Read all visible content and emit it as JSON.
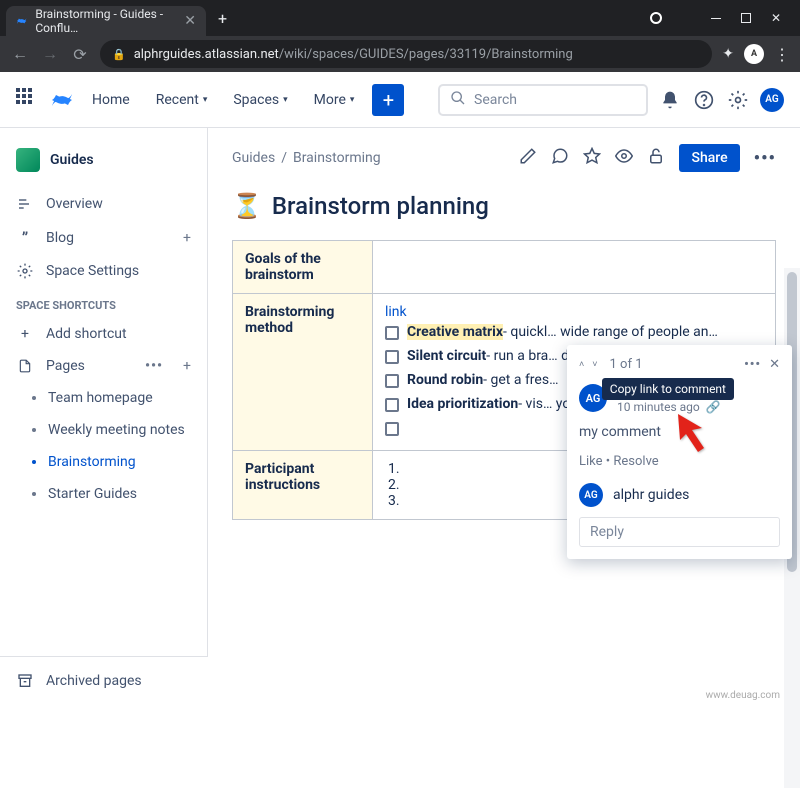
{
  "browser": {
    "tab_title": "Brainstorming - Guides - Conflu…",
    "url_host": "alphrguides.atlassian.net",
    "url_path": "/wiki/spaces/GUIDES/pages/33119/Brainstorming"
  },
  "topnav": {
    "home": "Home",
    "recent": "Recent",
    "spaces": "Spaces",
    "more": "More",
    "search_placeholder": "Search",
    "avatar": "AG"
  },
  "sidebar": {
    "space": "Guides",
    "overview": "Overview",
    "blog": "Blog",
    "space_settings": "Space Settings",
    "shortcuts_hdr": "SPACE SHORTCUTS",
    "add_shortcut": "Add shortcut",
    "pages": "Pages",
    "tree": {
      "team_homepage": "Team homepage",
      "weekly": "Weekly meeting notes",
      "brainstorming": "Brainstorming",
      "starter": "Starter Guides"
    },
    "archived": "Archived pages"
  },
  "breadcrumb": {
    "space": "Guides",
    "page": "Brainstorming"
  },
  "page_actions": {
    "share": "Share"
  },
  "page": {
    "title": "Brainstorm planning",
    "rows": {
      "goals_hdr": "Goals of the brainstorm",
      "method_hdr": "Brainstorming method",
      "method_link": "link",
      "cm_label": "Creative matrix",
      "cm_rest": "- quickl… wide range of people an…",
      "sc_label": "Silent circuit",
      "sc_rest": "- run a bra… different learning styles…",
      "rr_label": "Round robin",
      "rr_rest": "- get a fres…",
      "ip_label": "Idea prioritization",
      "ip_rest": "- vis… you should pursue first",
      "participant_hdr": "Participant instructions"
    }
  },
  "comment": {
    "count": "1 of 1",
    "user": "alphr guides",
    "time": "10 minutes ago",
    "text": "my comment",
    "like": "Like",
    "resolve": "Resolve",
    "reply_user": "alphr guides",
    "reply_placeholder": "Reply",
    "avatar": "AG",
    "tooltip": "Copy link to comment"
  },
  "watermark": "www.deuag.com"
}
